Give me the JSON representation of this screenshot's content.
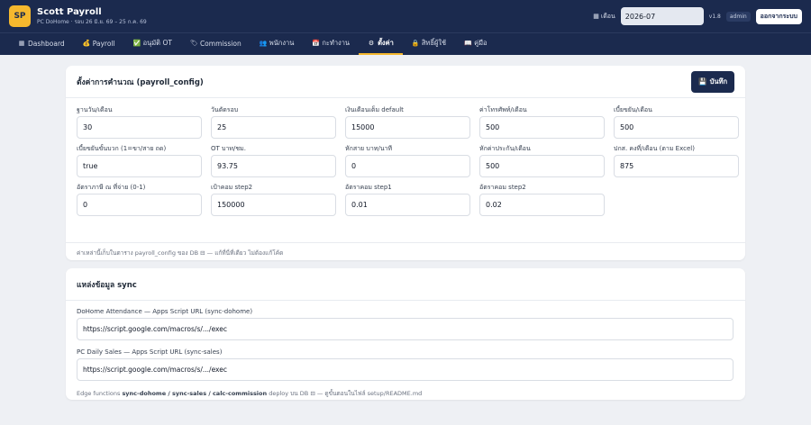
{
  "app": {
    "logo": "SP",
    "title": "Scott Payroll",
    "subtitle": "PC DoHome · รอบ 26 มิ.ย. 69 – 25 ก.ค. 69",
    "month_label": "เดือน",
    "month_value": "2026-07",
    "version": "v1.8",
    "role": "admin",
    "logout_label": "ออกจากระบบ"
  },
  "nav": {
    "tabs": [
      {
        "icon": "▦",
        "label": "Dashboard"
      },
      {
        "icon": "💰",
        "label": "Payroll"
      },
      {
        "icon": "✅",
        "label": "อนุมัติ OT"
      },
      {
        "icon": "🏷",
        "label": "Commission"
      },
      {
        "icon": "👥",
        "label": "พนักงาน"
      },
      {
        "icon": "📅",
        "label": "กะทำงาน"
      },
      {
        "icon": "⚙",
        "label": "ตั้งค่า"
      },
      {
        "icon": "🔒",
        "label": "สิทธิ์ผู้ใช้"
      },
      {
        "icon": "📖",
        "label": "คู่มือ"
      }
    ],
    "active_index": 6
  },
  "config": {
    "title": "ตั้งค่าการคำนวณ (payroll_config)",
    "save_label": "บันทึก",
    "fields": [
      {
        "label": "ฐานวัน/เดือน",
        "value": "30"
      },
      {
        "label": "วันตัดรอบ",
        "value": "25"
      },
      {
        "label": "เงินเดือนเต็ม default",
        "value": "15000"
      },
      {
        "label": "ค่าโทรศัพท์/เดือน",
        "value": "500"
      },
      {
        "label": "เบี้ยขยัน/เดือน",
        "value": "500"
      },
      {
        "label": "เบี้ยขยันขั้นบวก (1=ขา/สาย ถด)",
        "value": "true"
      },
      {
        "label": "OT บาท/ชม.",
        "value": "93.75"
      },
      {
        "label": "หักสาย บาท/นาที",
        "value": "0"
      },
      {
        "label": "หักค่าประกัน/เดือน",
        "value": "500"
      },
      {
        "label": "ปกส. คงที่/เดือน (ตาม Excel)",
        "value": "875"
      },
      {
        "label": "อัตราภาษี ณ ที่จ่าย (0-1)",
        "value": "0"
      },
      {
        "label": "เป้าคอม step2",
        "value": "150000"
      },
      {
        "label": "อัตราคอม step1",
        "value": "0.01"
      },
      {
        "label": "อัตราคอม step2",
        "value": "0.02"
      }
    ],
    "note": "ค่าเหล่านี้เก็บในตาราง payroll_config ของ DB ⊟ — แก้ที่นี่ที่เดียว ไม่ต้องแก้โค้ด"
  },
  "sync": {
    "title": "แหล่งข้อมูล sync",
    "attendance_label": "DoHome Attendance — Apps Script URL (sync-dohome)",
    "attendance_value": "https://script.google.com/macros/s/.../exec",
    "sales_label": "PC Daily Sales — Apps Script URL (sync-sales)",
    "sales_value": "https://script.google.com/macros/s/.../exec",
    "note_prefix": "Edge functions ",
    "note_functions": "sync-dohome / sync-sales / calc-commission",
    "note_suffix": " deploy บน DB ⊟ — ดูขั้นตอนในไฟล์ setup/README.md"
  }
}
